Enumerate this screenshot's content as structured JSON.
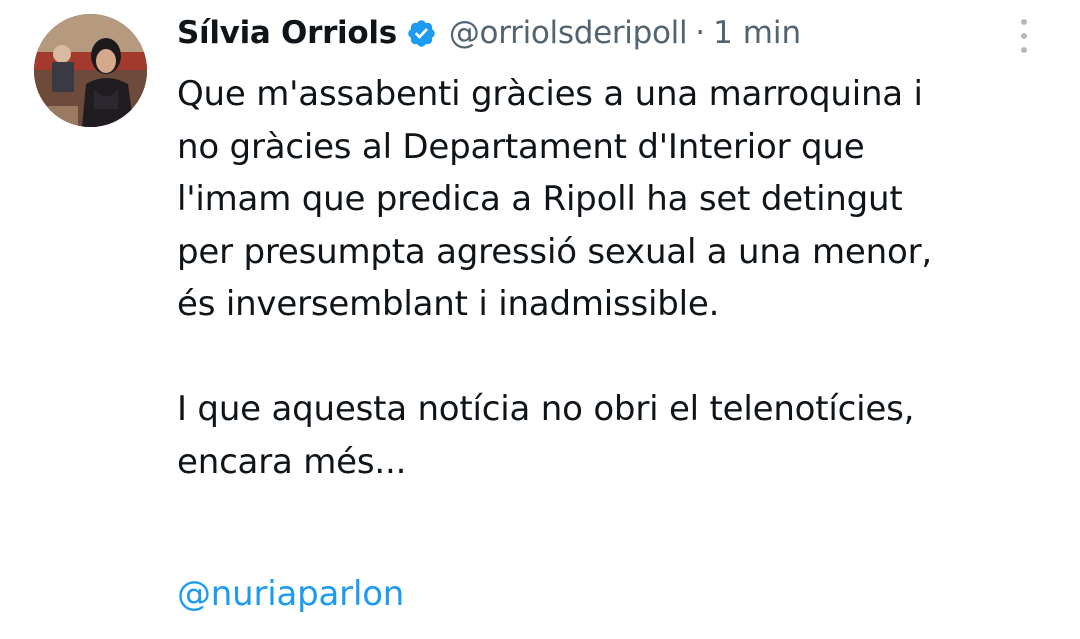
{
  "tweet": {
    "author": {
      "display_name": "Sílvia Orriols",
      "verified": true,
      "handle": "@orriolsderipoll",
      "avatar": "avatar-photo"
    },
    "separator": "·",
    "time": "1 min",
    "menu_icon": "more-vertical-icon",
    "paragraph1": [
      "Que m'assabenti gràcies a una marroquina i",
      "no gràcies al Departament d'Interior que",
      "l'imam que predica a Ripoll ha set detingut",
      "per presumpta agressió sexual a una menor,",
      "és inversemblant i inadmissible."
    ],
    "paragraph2": [
      "I que aquesta notícia no obri el telenotícies,",
      "encara més..."
    ],
    "mention": "@nuriaparlon"
  },
  "colors": {
    "text": "#0f1419",
    "muted": "#536471",
    "link": "#1d9bf0",
    "verified_badge": "#1d9bf0"
  }
}
